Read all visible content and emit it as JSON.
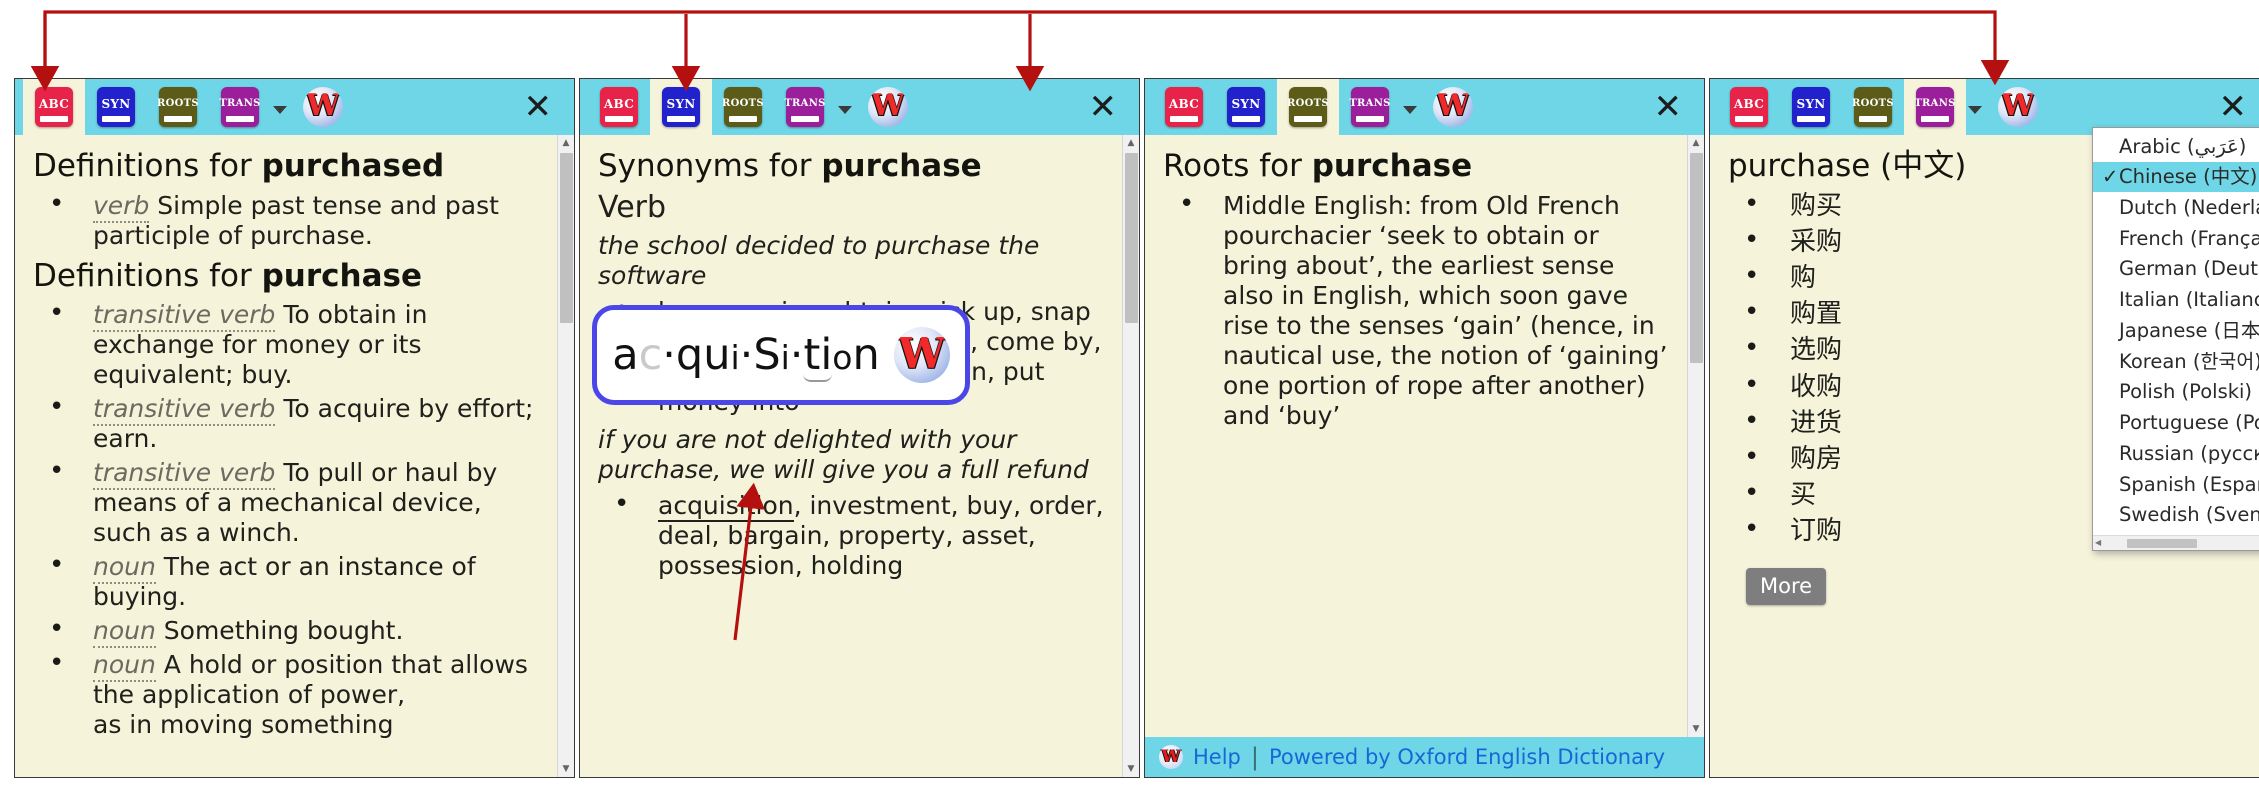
{
  "toolbar": {
    "buttons": [
      {
        "id": "abc",
        "label": "ABC",
        "name": "definitions-tab"
      },
      {
        "id": "syn",
        "label": "SYN",
        "name": "synonyms-tab"
      },
      {
        "id": "roots",
        "label": "ROOTS",
        "name": "roots-tab"
      },
      {
        "id": "trans",
        "label": "TRANS",
        "name": "translate-tab"
      }
    ],
    "wordweb_logo_label": "W",
    "close_label": "✕",
    "caret_icon": "chevron-down-icon"
  },
  "panel1": {
    "active_tab": "abc",
    "heading1_prefix": "Definitions for ",
    "heading1_word": "purchased",
    "entries1": [
      {
        "pos": "verb",
        "text": " Simple past tense and past participle of purchase."
      }
    ],
    "heading2_prefix": "Definitions for ",
    "heading2_word": "purchase",
    "entries2": [
      {
        "pos": "transitive verb",
        "text": " To obtain in exchange for money or its equivalent; buy."
      },
      {
        "pos": "transitive verb",
        "text": " To acquire by effort; earn."
      },
      {
        "pos": "transitive verb",
        "text": " To pull or haul by means of a mechanical device, such as a winch."
      },
      {
        "pos": "noun",
        "text": " The act or an instance of buying."
      },
      {
        "pos": "noun",
        "text": " Something bought."
      },
      {
        "pos": "noun",
        "text": " A hold or position that allows the application of power,"
      },
      {
        "pos": "",
        "text": "as in moving something"
      }
    ]
  },
  "panel2": {
    "active_tab": "syn",
    "heading_prefix": "Synonyms for ",
    "heading_word": "purchase",
    "pos_heading": "Verb",
    "example1": "the school decided to purchase the software",
    "synonyms1": "buy, acquire, obtain, pick up, snap up, take, secure, procure, come by, pay for, shop for, invest in, put money into",
    "example2": "if you are not delighted with your purchase, we will give you a full refund",
    "synonyms2_first": "acquisition",
    "synonyms2_rest": ", investment, buy, order, deal, bargain, property, asset, possession, holding",
    "popup": {
      "syllables": "ac·qui·si·tion",
      "parts": [
        {
          "t": "a",
          "style": "cap"
        },
        {
          "t": "c",
          "style": "dim"
        },
        {
          "t": "·",
          "style": "dot"
        },
        {
          "t": "q",
          "style": "cap"
        },
        {
          "t": "u",
          "style": "cap"
        },
        {
          "t": "i",
          "style": "sm"
        },
        {
          "t": "·",
          "style": "dot"
        },
        {
          "t": "S",
          "style": "cap"
        },
        {
          "t": "i",
          "style": "sm"
        },
        {
          "t": "·",
          "style": "dot"
        },
        {
          "t": "ti",
          "style": "und"
        },
        {
          "t": "o",
          "style": "sm"
        },
        {
          "t": "n",
          "style": "cap"
        }
      ]
    }
  },
  "panel3": {
    "active_tab": "roots",
    "heading_prefix": "Roots for ",
    "heading_word": "purchase",
    "root_text": "Middle English: from Old French pourchacier ‘seek to obtain or bring about’, the earliest sense also in English, which soon gave rise to the senses ‘gain’ (hence, in nautical use, the notion of ‘gaining’ one portion of rope after another) and ‘buy’",
    "footer": {
      "help_label": "Help",
      "help_icon": "wordweb-help-icon",
      "separator": "|",
      "powered_by": "Powered by Oxford English Dictionary"
    }
  },
  "panel4": {
    "active_tab": "trans",
    "heading": "purchase (中文)",
    "translations": [
      "购买",
      "采购",
      "购",
      "购置",
      "选购",
      "收购",
      "进货",
      "购房",
      "买",
      "订购"
    ],
    "more_label": "More",
    "language_menu": {
      "selected": "Chinese (中文)",
      "check_mark": "✓",
      "items": [
        "Arabic (عَرَبي)",
        "Chinese (中文)",
        "Dutch (Nederlands)",
        "French (Français)",
        "German (Deutsch)",
        "Italian (Italiano)",
        "Japanese (日本語)",
        "Korean (한국어)",
        "Polish (Polski)",
        "Portuguese (Português)",
        "Russian (русский)",
        "Spanish (Español)",
        "Swedish (Svenska)"
      ]
    }
  },
  "colors": {
    "toolbar": "#6ed6e6",
    "page_bg": "#f5f3da",
    "annotation_arrow": "#b41010",
    "popup_border": "#4a46e8",
    "link": "#1568d6"
  }
}
